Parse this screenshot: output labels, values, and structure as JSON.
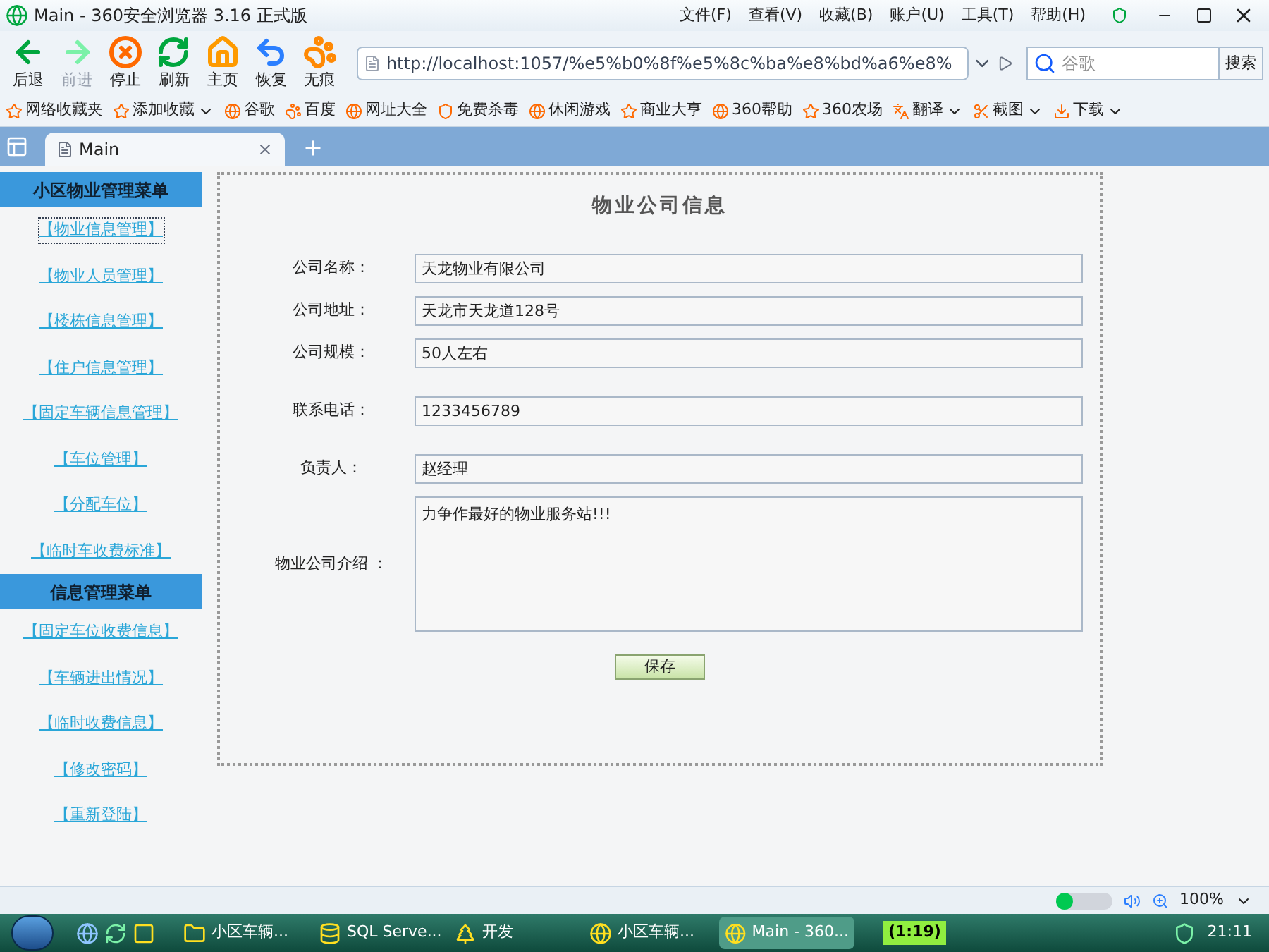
{
  "window": {
    "title": "Main - 360安全浏览器 3.16 正式版"
  },
  "menu": [
    "文件(F)",
    "查看(V)",
    "收藏(B)",
    "账户(U)",
    "工具(T)",
    "帮助(H)"
  ],
  "toolbar": [
    {
      "kind": "back",
      "label": "后退",
      "disabled": false
    },
    {
      "kind": "forward",
      "label": "前进",
      "disabled": true
    },
    {
      "kind": "stop",
      "label": "停止",
      "disabled": false
    },
    {
      "kind": "refresh",
      "label": "刷新",
      "disabled": false
    },
    {
      "kind": "home",
      "label": "主页",
      "disabled": false
    },
    {
      "kind": "undo",
      "label": "恢复",
      "disabled": false
    },
    {
      "kind": "private",
      "label": "无痕",
      "disabled": false
    }
  ],
  "address": {
    "value": "http://localhost:1057/%e5%b0%8f%e5%8c%ba%e8%bd%a6%e8%"
  },
  "search": {
    "placeholder": "谷歌",
    "button": "搜索"
  },
  "bookmarks": [
    {
      "label": "网络收藏夹",
      "dropdown": false
    },
    {
      "label": "添加收藏",
      "dropdown": true
    },
    {
      "label": "谷歌",
      "dropdown": false
    },
    {
      "label": "百度",
      "dropdown": false
    },
    {
      "label": "网址大全",
      "dropdown": false
    },
    {
      "label": "免费杀毒",
      "dropdown": false
    },
    {
      "label": "休闲游戏",
      "dropdown": false
    },
    {
      "label": "商业大亨",
      "dropdown": false
    },
    {
      "label": "360帮助",
      "dropdown": false
    },
    {
      "label": "360农场",
      "dropdown": false
    },
    {
      "label": "翻译",
      "dropdown": true
    },
    {
      "label": "截图",
      "dropdown": true
    },
    {
      "label": "下载",
      "dropdown": true
    }
  ],
  "tabs": [
    {
      "label": "Main",
      "selected": true
    }
  ],
  "sidebar": [
    {
      "title": "小区物业管理菜单",
      "items": [
        {
          "label": "【物业信息管理】",
          "selected": true
        },
        {
          "label": "【物业人员管理】",
          "selected": false
        },
        {
          "label": "【楼栋信息管理】",
          "selected": false
        },
        {
          "label": "【住户信息管理】",
          "selected": false
        },
        {
          "label": "【固定车辆信息管理】",
          "selected": false
        },
        {
          "label": "【车位管理】",
          "selected": false
        },
        {
          "label": "【分配车位】",
          "selected": false
        },
        {
          "label": "【临时车收费标准】",
          "selected": false
        }
      ]
    },
    {
      "title": "信息管理菜单",
      "items": [
        {
          "label": "【固定车位收费信息】",
          "selected": false
        },
        {
          "label": "【车辆进出情况】",
          "selected": false
        },
        {
          "label": "【临时收费信息】",
          "selected": false
        },
        {
          "label": "【修改密码】",
          "selected": false
        },
        {
          "label": "【重新登陆】",
          "selected": false
        }
      ]
    }
  ],
  "form": {
    "title": "物业公司信息",
    "fields": [
      {
        "kind": "input",
        "label": "公司名称：",
        "value": "天龙物业有限公司"
      },
      {
        "kind": "input",
        "label": "公司地址：",
        "value": "天龙市天龙道128号"
      },
      {
        "kind": "input",
        "label": "公司规模：",
        "value": "50人左右"
      },
      {
        "kind": "input",
        "label": "联系电话：",
        "value": "1233456789"
      },
      {
        "kind": "input",
        "label": "负责人：",
        "value": "赵经理"
      },
      {
        "kind": "textarea",
        "label": "物业公司介绍 ：",
        "value": "力争作最好的物业服务站!!!"
      }
    ],
    "save": "保存"
  },
  "status_bar": {
    "zoom": "100%"
  },
  "taskbar": {
    "items": [
      {
        "kind": "folder",
        "label": "小区车辆...",
        "selected": false
      },
      {
        "kind": "sql",
        "label": "SQL Serve...",
        "selected": false
      },
      {
        "kind": "tree",
        "label": "开发",
        "selected": false
      },
      {
        "kind": "app",
        "label": "小区车辆...",
        "selected": false
      },
      {
        "kind": "browser",
        "label": "Main - 360...",
        "selected": true
      }
    ],
    "timer": "(1:19)",
    "clock": "21:11"
  }
}
